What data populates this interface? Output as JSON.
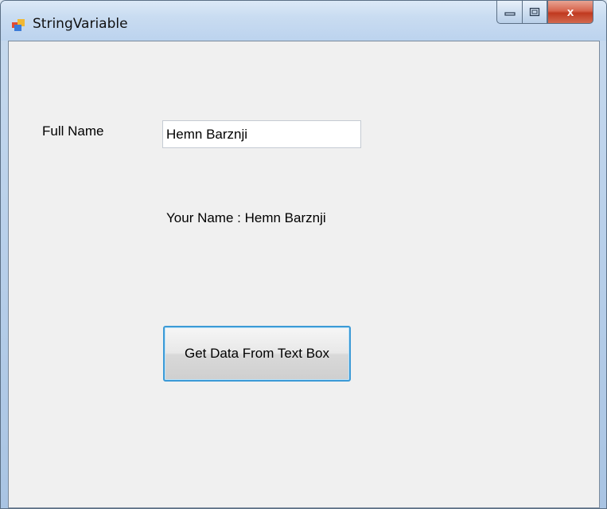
{
  "window": {
    "title": "StringVariable",
    "controls": {
      "minimize_icon": "minimize-icon",
      "maximize_icon": "maximize-icon",
      "close_icon": "close-icon",
      "close_glyph": "x"
    }
  },
  "form": {
    "full_name_label": "Full Name",
    "full_name_value": "Hemn Barznji",
    "output_label": "Your Name : Hemn Barznji",
    "button_label": "Get Data From Text Box"
  },
  "colors": {
    "client_background": "#f0f0f0",
    "button_focus_border": "#3c9ad6",
    "close_button": "#c0391f"
  }
}
